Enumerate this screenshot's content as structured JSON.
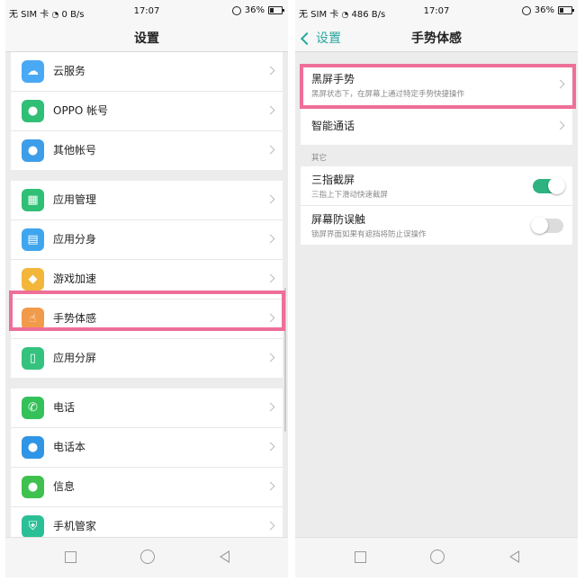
{
  "left": {
    "status": {
      "carrier": "无 SIM 卡",
      "speed": "0 B/s",
      "time": "17:07",
      "battery": "36%",
      "battery_level": 0.36
    },
    "title": "设置",
    "groups": [
      [
        {
          "label": "云服务",
          "icon": "cloud-icon",
          "color": "#4aa9f5",
          "glyph": "☁"
        },
        {
          "label": "OPPO 帐号",
          "icon": "user-icon",
          "color": "#2fbf76",
          "glyph": "●"
        },
        {
          "label": "其他帐号",
          "icon": "account-icon",
          "color": "#3e9de8",
          "glyph": "●"
        }
      ],
      [
        {
          "label": "应用管理",
          "icon": "apps-icon",
          "color": "#2fbf76",
          "glyph": "▦"
        },
        {
          "label": "应用分身",
          "icon": "app-clone-icon",
          "color": "#3ea6ee",
          "glyph": "▤"
        },
        {
          "label": "游戏加速",
          "icon": "gamepad-icon",
          "color": "#f2b63a",
          "glyph": "◆"
        },
        {
          "label": "手势体感",
          "icon": "gesture-icon",
          "color": "#f09a4a",
          "glyph": "☝"
        },
        {
          "label": "应用分屏",
          "icon": "split-screen-icon",
          "color": "#34c27f",
          "glyph": "▯"
        }
      ],
      [
        {
          "label": "电话",
          "icon": "phone-icon",
          "color": "#34c15a",
          "glyph": "✆"
        },
        {
          "label": "电话本",
          "icon": "contacts-icon",
          "color": "#2f95e6",
          "glyph": "●"
        },
        {
          "label": "信息",
          "icon": "message-icon",
          "color": "#3ec14e",
          "glyph": "●"
        },
        {
          "label": "手机管家",
          "icon": "phone-manager-icon",
          "color": "#2bbf96",
          "glyph": "⛨"
        }
      ]
    ]
  },
  "right": {
    "status": {
      "carrier": "无 SIM 卡",
      "speed": "486 B/s",
      "time": "17:07",
      "battery": "36%",
      "battery_level": 0.36
    },
    "back_label": "设置",
    "title": "手势体感",
    "rows": [
      {
        "title": "黑屏手势",
        "subtitle": "黑屏状态下，在屏幕上通过特定手势快捷操作"
      },
      {
        "title": "智能通话"
      }
    ],
    "section_label": "其它",
    "toggles": [
      {
        "title": "三指截屏",
        "subtitle": "三指上下滑动快速截屏",
        "state": "on"
      },
      {
        "title": "屏幕防误触",
        "subtitle": "锁屏界面如果有遮挡将防止误操作",
        "state": "off"
      }
    ]
  },
  "highlight_color": "#ee6f98"
}
